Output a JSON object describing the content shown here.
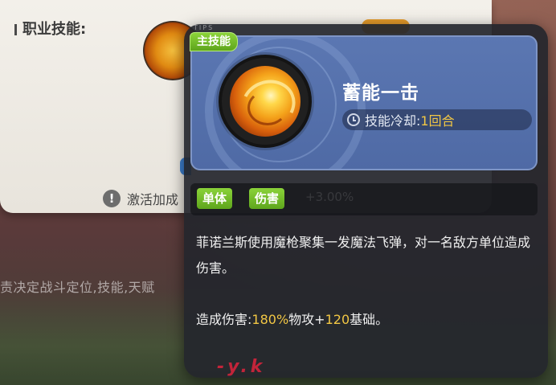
{
  "background": {
    "panel": {
      "skill_section_label": "职业技能:",
      "activate_icon": "!",
      "activate_text": "激活加成"
    },
    "caption_text": "责决定战斗定位,技能,天赋"
  },
  "tooltip": {
    "tips_tag": "TIPS",
    "main_skill_badge": "主技能",
    "skill_name": "蓄能一击",
    "cooldown": {
      "icon": "clock-icon",
      "label": "技能冷却:",
      "value": "1回合"
    },
    "tags": [
      "单体",
      "伤害"
    ],
    "tags_row_ghost_text": "+3.00%",
    "description": "菲诺兰斯使用魔枪聚集一发魔法飞弹，对一名敌方单位造成伤害。",
    "damage": {
      "prefix": "造成伤害:",
      "percent": "180%",
      "mid": "物攻+",
      "base": "120",
      "suffix": "基础。"
    },
    "watermark_text": "-y.k"
  },
  "colors": {
    "tag_green": "#6cbf24",
    "highlight_gold": "#f2c744",
    "header_blue": "#5570aa"
  }
}
